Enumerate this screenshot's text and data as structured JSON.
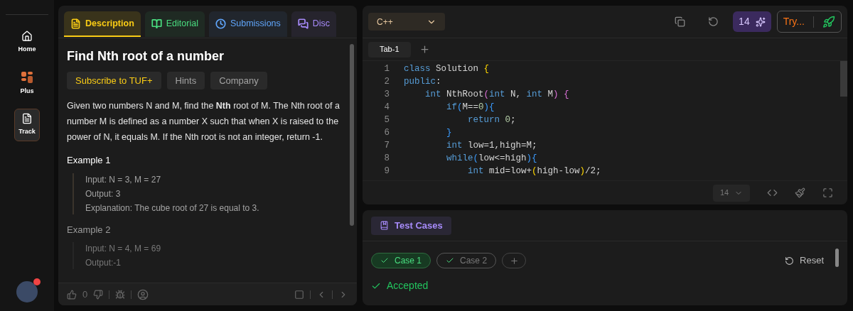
{
  "sidebar": {
    "items": [
      {
        "label": "Home",
        "kind": "home",
        "selected": false
      },
      {
        "label": "Plus",
        "kind": "plus",
        "selected": false
      },
      {
        "label": "Track",
        "kind": "track",
        "selected": true
      }
    ],
    "notification": true
  },
  "problem_tabs": [
    {
      "label": "Description",
      "kind": "doc",
      "color": "#facc15",
      "selected": true
    },
    {
      "label": "Editorial",
      "kind": "book",
      "color": "#4ade80",
      "selected": false
    },
    {
      "label": "Submissions",
      "kind": "clock",
      "color": "#60a5fa",
      "selected": false
    },
    {
      "label": "Disc",
      "kind": "chat",
      "color": "#a78bfa",
      "selected": false
    }
  ],
  "problem": {
    "title": "Find Nth root of a number",
    "chips": [
      {
        "label": "Subscribe to TUF+",
        "kind": "premium"
      },
      {
        "label": "Hints",
        "kind": "plain"
      },
      {
        "label": "Company",
        "kind": "plain"
      }
    ],
    "statement": "Given two numbers N and M, find the **Nth** root of M. The Nth root of a number M is defined as a number X such that when X is raised to the power of N, it equals M. If the Nth root is not an integer, return -1.",
    "examples": [
      {
        "heading": "Example 1",
        "lines": [
          "Input: N = 3, M = 27",
          "Output: 3",
          "Explanation: The cube root of 27 is equal to 3."
        ],
        "faded": false
      },
      {
        "heading": "Example 2",
        "lines": [
          "Input: N = 4, M = 69",
          "Output:-1"
        ],
        "faded": true
      }
    ]
  },
  "footer": {
    "likes": "0"
  },
  "editor": {
    "language": "C++",
    "streak": "14",
    "try_label": "Try...",
    "tabs": [
      {
        "label": "Tab-1",
        "selected": true
      }
    ],
    "lines": [
      {
        "number": "1",
        "tokens": [
          {
            "t": "class ",
            "kind": "kw"
          },
          {
            "t": "Solution ",
            "kind": "plain"
          },
          {
            "t": "{",
            "kind": "brace"
          }
        ]
      },
      {
        "number": "2",
        "tokens": [
          {
            "t": "public",
            "kind": "kw"
          },
          {
            "t": ":",
            "kind": "plain"
          }
        ]
      },
      {
        "number": "3",
        "tokens": [
          {
            "t": "    int ",
            "kind": "kw"
          },
          {
            "t": "NthRoot",
            "kind": "plain"
          },
          {
            "t": "(",
            "kind": "paren"
          },
          {
            "t": "int ",
            "kind": "kw"
          },
          {
            "t": "N, ",
            "kind": "plain"
          },
          {
            "t": "int ",
            "kind": "kw"
          },
          {
            "t": "M",
            "kind": "plain"
          },
          {
            "t": ") {",
            "kind": "paren"
          }
        ]
      },
      {
        "number": "4",
        "tokens": [
          {
            "t": "        if",
            "kind": "kw"
          },
          {
            "t": "(",
            "kind": "brace2"
          },
          {
            "t": "M==",
            "kind": "plain"
          },
          {
            "t": "0",
            "kind": "num"
          },
          {
            "t": "){",
            "kind": "brace2"
          }
        ]
      },
      {
        "number": "5",
        "tokens": [
          {
            "t": "            return ",
            "kind": "kw"
          },
          {
            "t": "0",
            "kind": "num"
          },
          {
            "t": ";",
            "kind": "plain"
          }
        ]
      },
      {
        "number": "6",
        "tokens": [
          {
            "t": "        }",
            "kind": "brace2"
          }
        ]
      },
      {
        "number": "7",
        "tokens": [
          {
            "t": "        int ",
            "kind": "kw"
          },
          {
            "t": "low=1,high=M;",
            "kind": "plain"
          }
        ]
      },
      {
        "number": "8",
        "tokens": [
          {
            "t": "        while",
            "kind": "kw"
          },
          {
            "t": "(",
            "kind": "brace2"
          },
          {
            "t": "low<=high",
            "kind": "plain"
          },
          {
            "t": "){",
            "kind": "brace2"
          }
        ]
      },
      {
        "number": "9",
        "tokens": [
          {
            "t": "            int ",
            "kind": "kw"
          },
          {
            "t": "mid=low+",
            "kind": "plain"
          },
          {
            "t": "(",
            "kind": "brace"
          },
          {
            "t": "high-low",
            "kind": "plain"
          },
          {
            "t": ")",
            "kind": "brace"
          },
          {
            "t": "/2;",
            "kind": "plain"
          }
        ]
      }
    ],
    "font_size": "14"
  },
  "test_panel": {
    "tab": "Test Cases",
    "reset": "Reset",
    "result": "Accepted",
    "cases": [
      {
        "label": "Case 1",
        "selected": true,
        "passed": true
      },
      {
        "label": "Case 2",
        "selected": false,
        "passed": true
      }
    ]
  }
}
